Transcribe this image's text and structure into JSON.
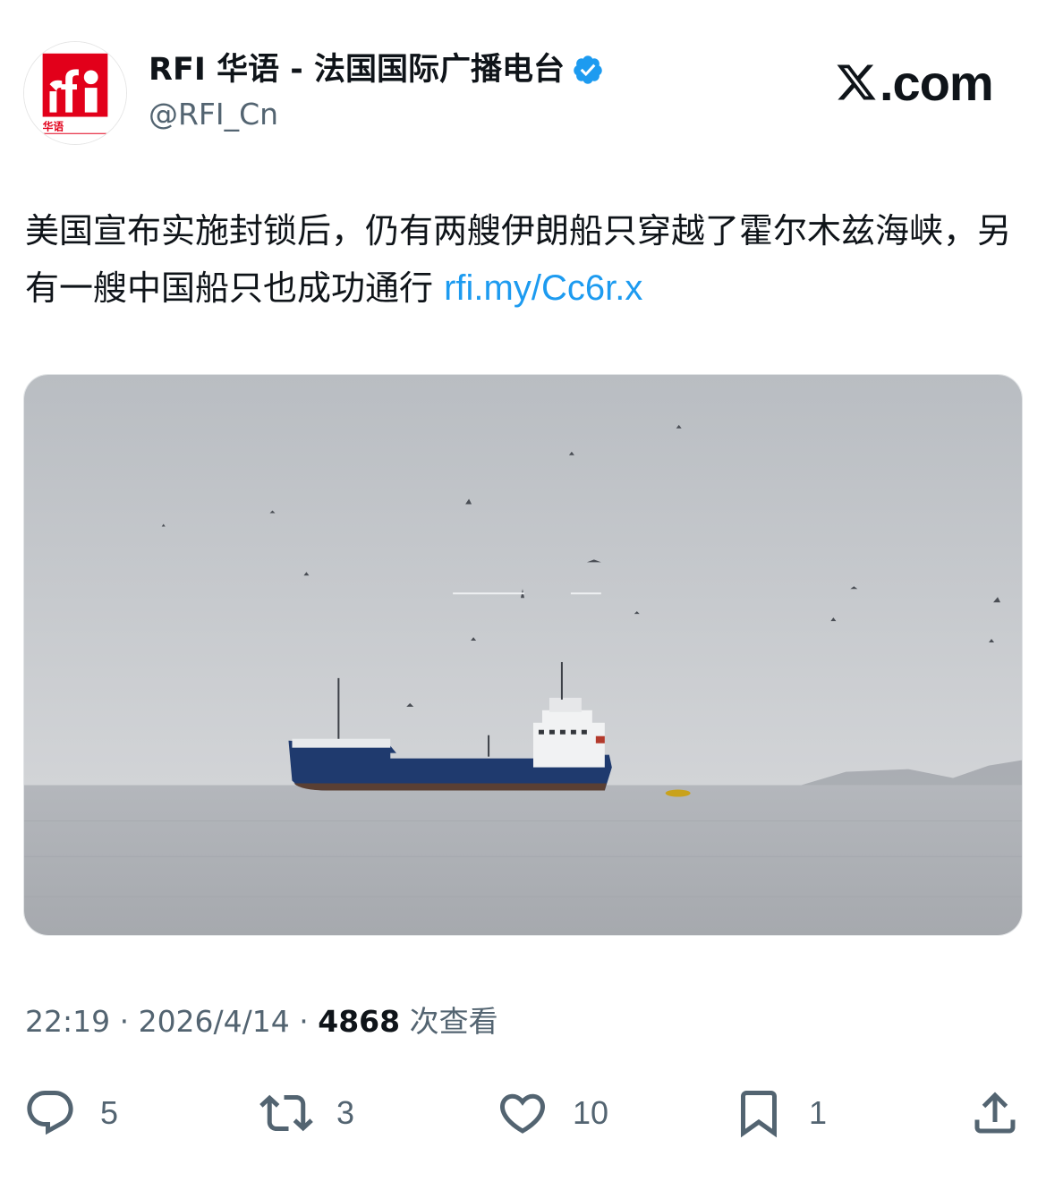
{
  "account": {
    "display_name": "RFI 华语 - 法国国际广播电台",
    "handle": "@RFI_Cn",
    "avatar_logo_text": "rfi",
    "avatar_sub_text": "华语",
    "verified": true
  },
  "brand": {
    "site": ".com"
  },
  "tweet": {
    "text": "美国宣布实施封锁后，仍有两艘伊朗船只穿越了霍尔木兹海峡，另有一艘中国船只也成功通行 ",
    "link": "rfi.my/Cc6r.x",
    "time": "22:19 · 2026/4/14 · ",
    "views_count": "4868",
    "views_label": " 次查看"
  },
  "actions": {
    "replies": "5",
    "reposts": "3",
    "likes": "10",
    "bookmarks": "1"
  },
  "colors": {
    "accent": "#1d9bf0",
    "rfi_red": "#e2001a",
    "secondary_text": "#536471"
  }
}
